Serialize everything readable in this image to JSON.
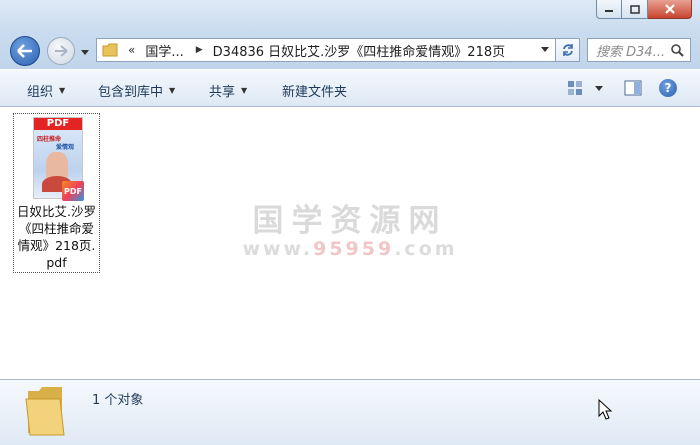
{
  "window": {
    "caption": {
      "minimize": "minimize",
      "maximize": "maximize",
      "close": "close"
    }
  },
  "navigation": {
    "address": {
      "overflow": "«",
      "segments": [
        "国学...",
        "D34836 日奴比艾.沙罗《四柱推命爱情观》218页"
      ]
    },
    "search": {
      "placeholder": "搜索 D34..."
    }
  },
  "toolbar": {
    "organize": "组织",
    "include_in_library": "包含到库中",
    "share": "共享",
    "new_folder": "新建文件夹"
  },
  "content": {
    "files": [
      {
        "name": "日奴比艾.沙罗\n《四柱推命爱\n情观》218页.\npdf",
        "thumb_header": "PDF",
        "thumb_title": "四柱推命",
        "thumb_subtitle": "爱情观",
        "badge": "PDF",
        "type_icon": "pdf-file-icon"
      }
    ],
    "watermark": {
      "line1": "国学资源网",
      "line2_prefix": "www.",
      "line2_num": "95959",
      "line2_suffix": ".com"
    }
  },
  "details": {
    "count_text": "1 个对象"
  },
  "colors": {
    "titlebar": "#c9dbee",
    "accent": "#2d62b5",
    "close": "#c9452f"
  }
}
